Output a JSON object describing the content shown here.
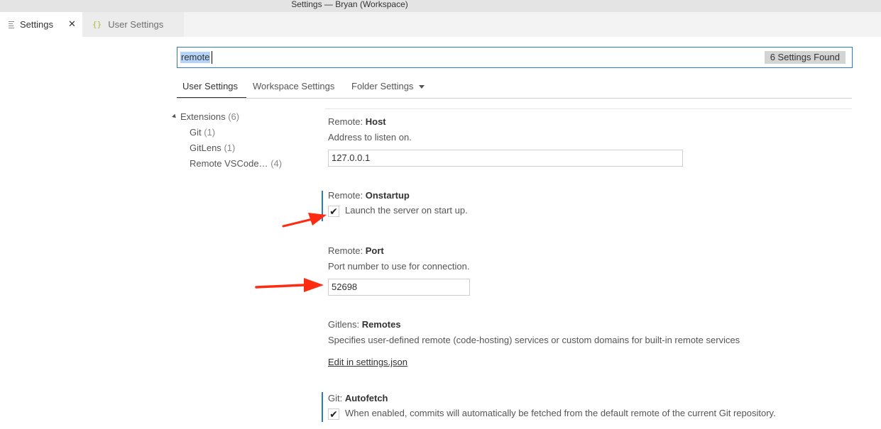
{
  "window": {
    "title": "Settings — Bryan (Workspace)"
  },
  "tabs": [
    {
      "label": "Settings",
      "icon": "lines-icon",
      "active": true
    },
    {
      "label": "User Settings",
      "icon": "braces-icon",
      "active": false
    }
  ],
  "tab_close_glyph": "✕",
  "braces_glyph": "{}",
  "search": {
    "value": "remote",
    "result_badge": "6 Settings Found"
  },
  "scopes": {
    "user": "User Settings",
    "workspace": "Workspace Settings",
    "folder": "Folder Settings"
  },
  "toc": {
    "extensions": {
      "label": "Extensions",
      "count": "(6)"
    },
    "items": [
      {
        "label": "Git",
        "count": "(1)"
      },
      {
        "label": "GitLens",
        "count": "(1)"
      },
      {
        "label": "Remote VSCode…",
        "count": "(4)"
      }
    ]
  },
  "settings": {
    "host": {
      "category": "Remote: ",
      "name": "Host",
      "description": "Address to listen on.",
      "value": "127.0.0.1"
    },
    "onstartup": {
      "category": "Remote: ",
      "name": "Onstartup",
      "description": "Launch the server on start up.",
      "checked": true
    },
    "port": {
      "category": "Remote: ",
      "name": "Port",
      "description": "Port number to use for connection.",
      "value": "52698"
    },
    "remotes": {
      "category": "Gitlens: ",
      "name": "Remotes",
      "description": "Specifies user-defined remote (code-hosting) services or custom domains for built-in remote services",
      "link": "Edit in settings.json"
    },
    "autofetch": {
      "category": "Git: ",
      "name": "Autofetch",
      "description": "When enabled, commits will automatically be fetched from the default remote of the current Git repository.",
      "checked": true
    }
  },
  "check_glyph": "✔",
  "colors": {
    "accent": "#2a7ac9",
    "annotation_arrow": "#ff2a12",
    "selection": "#b3d4f6"
  }
}
